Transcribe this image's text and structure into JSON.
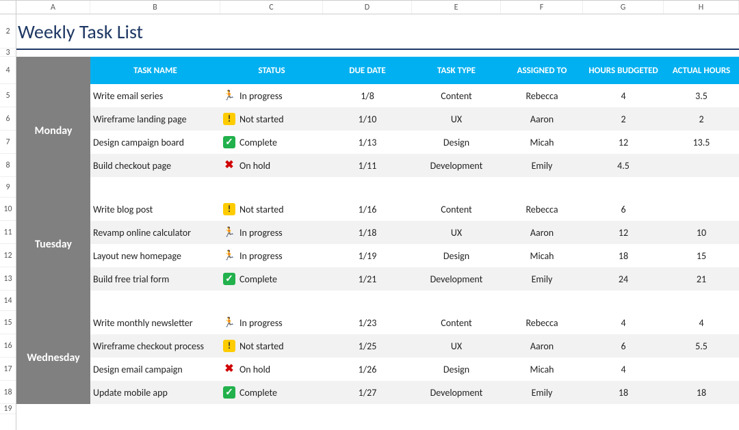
{
  "columns": [
    "A",
    "B",
    "C",
    "D",
    "E",
    "F",
    "G",
    "H"
  ],
  "row_labels": [
    "2",
    "3",
    "4",
    "5",
    "6",
    "7",
    "8",
    "9",
    "10",
    "11",
    "12",
    "13",
    "14",
    "15",
    "16",
    "17",
    "18",
    "19"
  ],
  "title": "Weekly Task List",
  "headers": {
    "task_name": "TASK NAME",
    "status": "STATUS",
    "due_date": "DUE DATE",
    "task_type": "TASK TYPE",
    "assigned_to": "ASSIGNED TO",
    "hours_budgeted": "HOURS BUDGETED",
    "actual_hours": "ACTUAL HOURS"
  },
  "status_labels": {
    "in_progress": "In progress",
    "not_started": "Not started",
    "complete": "Complete",
    "on_hold": "On hold"
  },
  "status_icons": {
    "in_progress": "🏃",
    "not_started": "!",
    "complete": "✓",
    "on_hold": "✖"
  },
  "days": [
    {
      "name": "Monday",
      "tasks": [
        {
          "name": "Write email series",
          "status": "in_progress",
          "due": "1/8",
          "type": "Content",
          "assigned": "Rebecca",
          "budget": "4",
          "actual": "3.5"
        },
        {
          "name": "Wireframe landing page",
          "status": "not_started",
          "due": "1/10",
          "type": "UX",
          "assigned": "Aaron",
          "budget": "2",
          "actual": "2"
        },
        {
          "name": "Design campaign board",
          "status": "complete",
          "due": "1/13",
          "type": "Design",
          "assigned": "Micah",
          "budget": "12",
          "actual": "13.5"
        },
        {
          "name": "Build checkout page",
          "status": "on_hold",
          "due": "1/11",
          "type": "Development",
          "assigned": "Emily",
          "budget": "4.5",
          "actual": ""
        }
      ]
    },
    {
      "name": "Tuesday",
      "tasks": [
        {
          "name": "Write blog post",
          "status": "not_started",
          "due": "1/16",
          "type": "Content",
          "assigned": "Rebecca",
          "budget": "6",
          "actual": ""
        },
        {
          "name": "Revamp online calculator",
          "status": "in_progress",
          "due": "1/18",
          "type": "UX",
          "assigned": "Aaron",
          "budget": "12",
          "actual": "10"
        },
        {
          "name": "Layout new homepage",
          "status": "in_progress",
          "due": "1/19",
          "type": "Design",
          "assigned": "Micah",
          "budget": "18",
          "actual": "15"
        },
        {
          "name": "Build free trial form",
          "status": "complete",
          "due": "1/21",
          "type": "Development",
          "assigned": "Emily",
          "budget": "24",
          "actual": "21"
        }
      ]
    },
    {
      "name": "Wednesday",
      "tasks": [
        {
          "name": "Write monthly newsletter",
          "status": "in_progress",
          "due": "1/23",
          "type": "Content",
          "assigned": "Rebecca",
          "budget": "4",
          "actual": "4"
        },
        {
          "name": "Wireframe checkout process",
          "status": "not_started",
          "due": "1/25",
          "type": "UX",
          "assigned": "Aaron",
          "budget": "6",
          "actual": "5.5"
        },
        {
          "name": "Design email campaign",
          "status": "on_hold",
          "due": "1/26",
          "type": "Design",
          "assigned": "Micah",
          "budget": "4",
          "actual": ""
        },
        {
          "name": "Update mobile app",
          "status": "complete",
          "due": "1/27",
          "type": "Development",
          "assigned": "Emily",
          "budget": "18",
          "actual": "18"
        }
      ]
    }
  ],
  "row_heights": {
    "title": 50,
    "rule": 12,
    "header": 40,
    "task": 34,
    "spacer": 30,
    "tail": 15
  }
}
